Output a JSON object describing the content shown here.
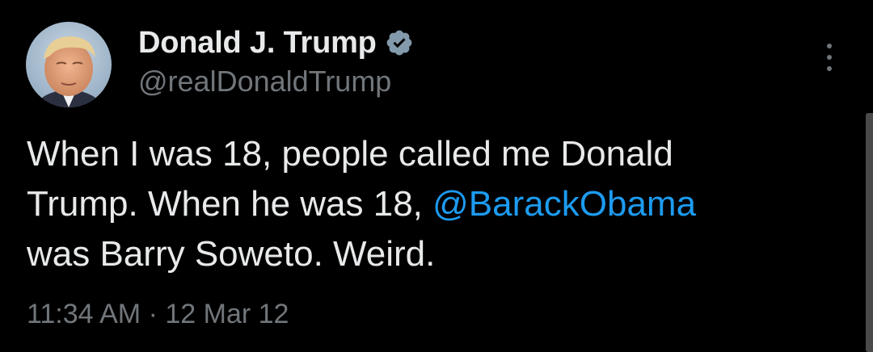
{
  "author": {
    "display_name": "Donald J. Trump",
    "handle": "@realDonaldTrump",
    "verified_icon": "verified-badge-icon",
    "avatar_icon": "profile-photo"
  },
  "more_icon": "more-vertical-icon",
  "tweet": {
    "line1": "When I was 18, people called me Donald",
    "line2_prefix": "Trump. When he was 18, ",
    "mention": "@BarackObama",
    "line3": "was Barry Soweto. Weird.",
    "time": "11:34 AM",
    "separator": " · ",
    "date": "12 Mar 12"
  },
  "colors": {
    "background": "#000000",
    "text": "#e7e9ea",
    "secondary": "#71767b",
    "link": "#1d9bf0",
    "verified_badge": "#829aab"
  }
}
